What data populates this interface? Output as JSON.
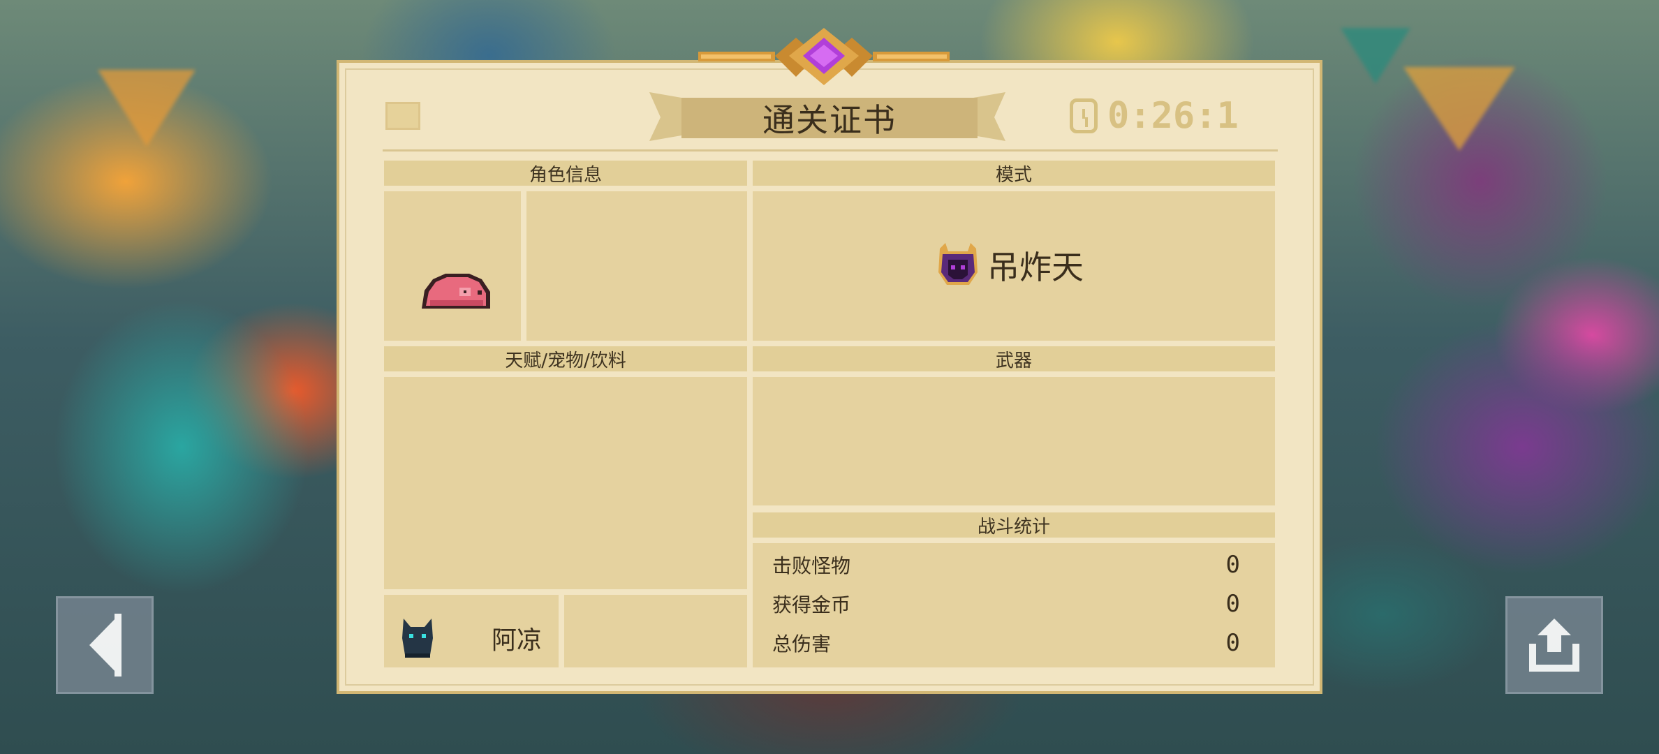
{
  "certificate": {
    "title": "通关证书",
    "timer": "0:26:1",
    "sections": {
      "character": "角色信息",
      "mode": "模式",
      "talents": "天赋/宠物/饮料",
      "weapons": "武器",
      "battle_stats": "战斗统计"
    },
    "mode_name": "吊炸天",
    "pet_name": "阿凉",
    "stats": [
      {
        "label": "击败怪物",
        "value": "0"
      },
      {
        "label": "获得金币",
        "value": "0"
      },
      {
        "label": "总伤害",
        "value": "0"
      }
    ]
  },
  "icons": {
    "calendar": "calendar-icon",
    "clock": "clock-icon",
    "character": "pink-pig-character-icon",
    "mode": "purple-demon-helmet-icon",
    "pet": "black-cat-pet-icon",
    "back": "back-arrow-icon",
    "share": "share-icon"
  },
  "colors": {
    "panel_bg": "#f2e5c3",
    "section_bg": "#e2cf98",
    "gem": "#b13fd9",
    "gold": "#d89a3a"
  }
}
